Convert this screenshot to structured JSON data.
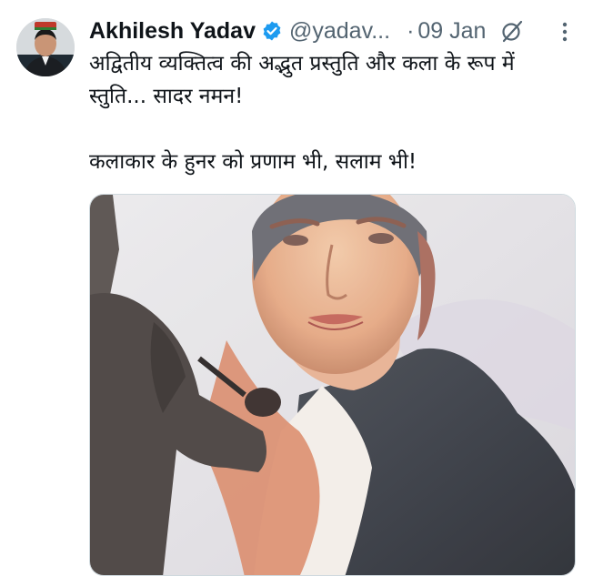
{
  "tweet": {
    "author_name": "Akhilesh Yadav",
    "author_handle": "@yadav...",
    "separator": "·",
    "date": "09 Jan",
    "text_line1": "अद्वितीय व्यक्तित्व की अद्भुत प्रस्तुति और कला के रूप में स्तुति... सादर नमन!",
    "text_line2": "कलाकार के हुनर को प्रणाम भी, सलाम भी!",
    "verified": true
  },
  "icons": {
    "verified": "verified-badge-icon",
    "grok": "grok-icon",
    "more": "more-options-icon"
  },
  "colors": {
    "verified_blue": "#1d9bf0",
    "secondary_text": "#536471",
    "primary_text": "#0f1419"
  }
}
